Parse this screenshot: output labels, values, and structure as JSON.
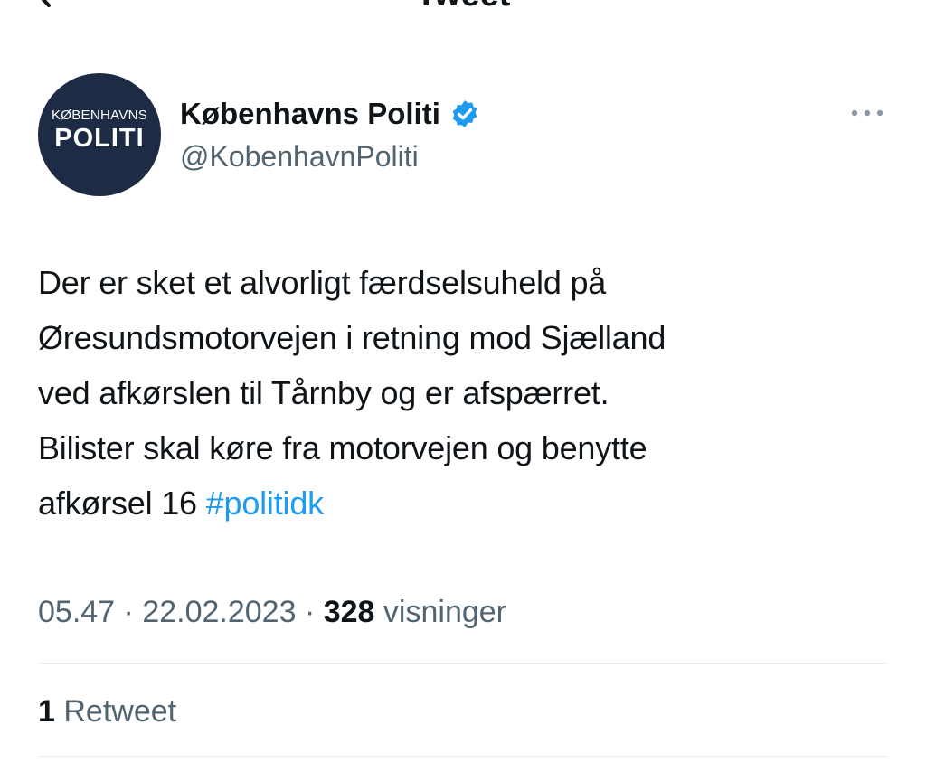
{
  "header": {
    "title": "Tweet",
    "back_icon": "back-arrow-icon"
  },
  "author": {
    "display_name": "Københavns Politi",
    "handle": "@KobenhavnPoliti",
    "verified": true,
    "avatar": {
      "line1": "KØBENHAVNS",
      "line2": "POLITI"
    }
  },
  "menu": {
    "more_icon": "more-options-icon"
  },
  "tweet": {
    "lines": [
      "Der er sket et alvorligt færdselsuheld på",
      "Øresundsmotorvejen i retning mod Sjælland",
      "ved afkørslen til Tårnby og er afspærret.",
      "Bilister skal køre fra motorvejen og benytte",
      "afkørsel 16 "
    ],
    "hashtag": "#politidk"
  },
  "meta": {
    "time": "05.47",
    "separator": "·",
    "date": "22.02.2023",
    "views_count": "328",
    "views_label": "visninger"
  },
  "stats": {
    "retweet_count": "1",
    "retweet_label": "Retweet"
  },
  "colors": {
    "link": "#1d9bf0",
    "secondary_text": "#536471",
    "avatar_bg": "#1d2b44",
    "verified": "#1d9bf0"
  }
}
